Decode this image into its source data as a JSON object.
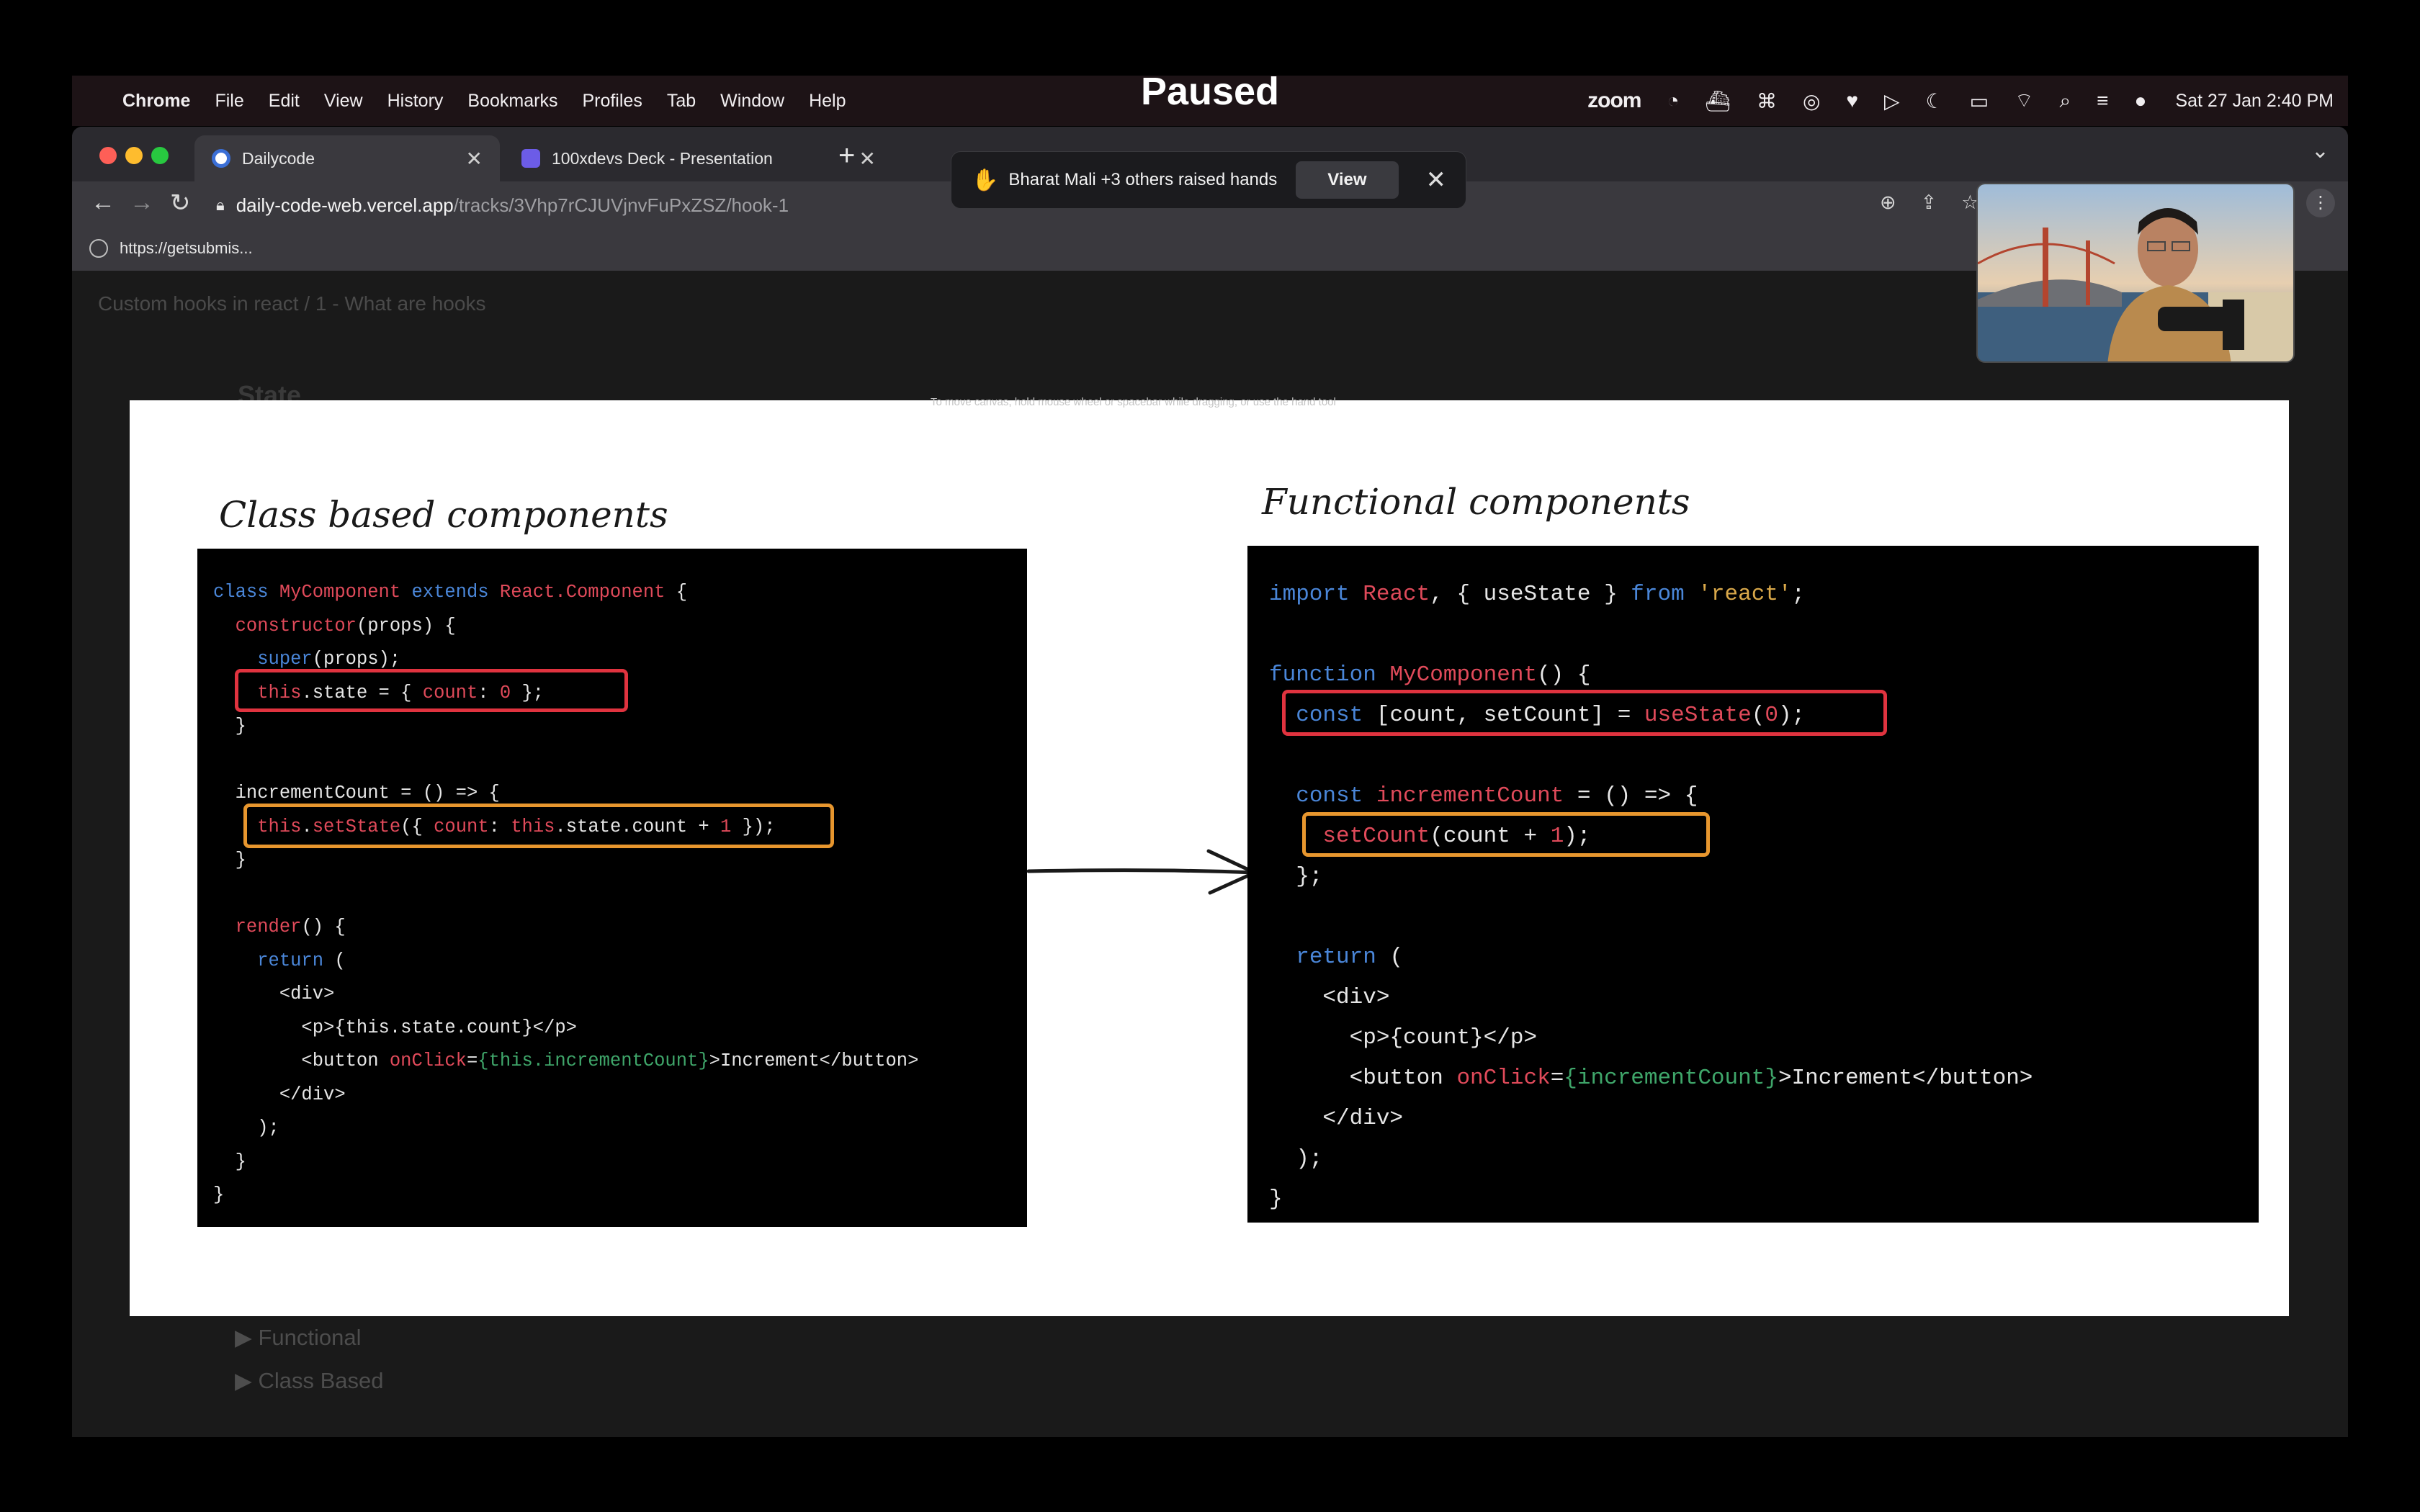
{
  "menubar": {
    "app": "Chrome",
    "items": [
      "File",
      "Edit",
      "View",
      "History",
      "Bookmarks",
      "Profiles",
      "Tab",
      "Window",
      "Help"
    ],
    "paused": "Paused",
    "tray_app": "zoom",
    "datetime": "Sat 27 Jan  2:40 PM"
  },
  "tabs": [
    {
      "title": "Dailycode",
      "active": true
    },
    {
      "title": "100xdevs Deck - Presentation",
      "active": false
    }
  ],
  "address": {
    "host": "daily-code-web.vercel.app",
    "path": "/tracks/3Vhp7rCJUVjnvFuPxZSZ/hook-1"
  },
  "bookmark": {
    "label": "https://getsubmis..."
  },
  "toast": {
    "message": "Bharat Mali +3 others raised hands",
    "action": "View"
  },
  "page": {
    "breadcrumb": "Custom hooks in react  /  1 - What are hooks",
    "heading": "State",
    "canvas_hint": "To move canvas, hold mouse wheel or spacebar while dragging, or use the hand tool",
    "left_title": "Class based components",
    "right_title": "Functional components",
    "collapsibles": [
      "▶ Functional",
      "▶ Class Based"
    ]
  },
  "class_code": [
    [
      [
        "k",
        "class "
      ],
      [
        "r",
        "MyComponent "
      ],
      [
        "k",
        "extends "
      ],
      [
        "r",
        "React.Component"
      ],
      [
        "t",
        " {"
      ]
    ],
    [
      [
        "t",
        "  "
      ],
      [
        "r",
        "constructor"
      ],
      [
        "t",
        "(props) {"
      ]
    ],
    [
      [
        "t",
        "    "
      ],
      [
        "k",
        "super"
      ],
      [
        "t",
        "(props);"
      ]
    ],
    [
      [
        "t",
        "    "
      ],
      [
        "r",
        "this"
      ],
      [
        "t",
        ".state = { "
      ],
      [
        "r",
        "count"
      ],
      [
        "t",
        ": "
      ],
      [
        "r",
        "0"
      ],
      [
        "t",
        " };"
      ]
    ],
    [
      [
        "t",
        "  }"
      ]
    ],
    [
      [
        "t",
        ""
      ]
    ],
    [
      [
        "t",
        "  incrementCount = () => {"
      ]
    ],
    [
      [
        "t",
        "    "
      ],
      [
        "r",
        "this"
      ],
      [
        "t",
        "."
      ],
      [
        "r",
        "setState"
      ],
      [
        "t",
        "({ "
      ],
      [
        "r",
        "count"
      ],
      [
        "t",
        ": "
      ],
      [
        "r",
        "this"
      ],
      [
        "t",
        ".state.count + "
      ],
      [
        "r",
        "1"
      ],
      [
        "t",
        " });"
      ]
    ],
    [
      [
        "t",
        "  }"
      ]
    ],
    [
      [
        "t",
        ""
      ]
    ],
    [
      [
        "t",
        "  "
      ],
      [
        "r",
        "render"
      ],
      [
        "t",
        "() {"
      ]
    ],
    [
      [
        "t",
        "    "
      ],
      [
        "k",
        "return"
      ],
      [
        "t",
        " ("
      ]
    ],
    [
      [
        "t",
        "      <div>"
      ]
    ],
    [
      [
        "t",
        "        <p>{this.state.count}</p>"
      ]
    ],
    [
      [
        "t",
        "        <button "
      ],
      [
        "r",
        "onClick"
      ],
      [
        "t",
        "="
      ],
      [
        "g",
        "{this.incrementCount}"
      ],
      [
        "t",
        ">Increment</button>"
      ]
    ],
    [
      [
        "t",
        "      </div>"
      ]
    ],
    [
      [
        "t",
        "    );"
      ]
    ],
    [
      [
        "t",
        "  }"
      ]
    ],
    [
      [
        "t",
        "}"
      ]
    ]
  ],
  "func_code": [
    [
      [
        "k",
        "import "
      ],
      [
        "r",
        "React"
      ],
      [
        "t",
        ", { useState } "
      ],
      [
        "k",
        "from "
      ],
      [
        "s",
        "'react'"
      ],
      [
        "t",
        ";"
      ]
    ],
    [
      [
        "t",
        ""
      ]
    ],
    [
      [
        "k",
        "function "
      ],
      [
        "r",
        "MyComponent"
      ],
      [
        "t",
        "() {"
      ]
    ],
    [
      [
        "t",
        "  "
      ],
      [
        "k",
        "const"
      ],
      [
        "t",
        " [count, setCount] = "
      ],
      [
        "r",
        "useState"
      ],
      [
        "t",
        "("
      ],
      [
        "r",
        "0"
      ],
      [
        "t",
        ");"
      ]
    ],
    [
      [
        "t",
        ""
      ]
    ],
    [
      [
        "t",
        "  "
      ],
      [
        "k",
        "const "
      ],
      [
        "r",
        "incrementCount"
      ],
      [
        "t",
        " = () => {"
      ]
    ],
    [
      [
        "t",
        "    "
      ],
      [
        "r",
        "setCount"
      ],
      [
        "t",
        "(count + "
      ],
      [
        "r",
        "1"
      ],
      [
        "t",
        ");"
      ]
    ],
    [
      [
        "t",
        "  };"
      ]
    ],
    [
      [
        "t",
        ""
      ]
    ],
    [
      [
        "t",
        "  "
      ],
      [
        "k",
        "return"
      ],
      [
        "t",
        " ("
      ]
    ],
    [
      [
        "t",
        "    <div>"
      ]
    ],
    [
      [
        "t",
        "      <p>{count}</p>"
      ]
    ],
    [
      [
        "t",
        "      <button "
      ],
      [
        "r",
        "onClick"
      ],
      [
        "t",
        "="
      ],
      [
        "g",
        "{incrementCount}"
      ],
      [
        "t",
        ">Increment</button>"
      ]
    ],
    [
      [
        "t",
        "    </div>"
      ]
    ],
    [
      [
        "t",
        "  );"
      ]
    ],
    [
      [
        "t",
        "}"
      ]
    ]
  ],
  "colors": {
    "keyword": "#4a86d8",
    "identifier": "#e04a5a",
    "string": "#d9a84a",
    "jsx_expr": "#3fa66a",
    "highlight_red": "#e0333f",
    "highlight_orange": "#e7962e"
  },
  "icons": [
    "apple-icon",
    "zoom-icon",
    "wifi-icon",
    "search-icon",
    "battery-icon",
    "lock-icon",
    "back-icon",
    "forward-icon",
    "reload-icon",
    "zoom-in-icon",
    "share-icon",
    "star-icon",
    "kebab-menu-icon",
    "raised-hand-icon",
    "close-icon",
    "arrow-right-icon"
  ]
}
